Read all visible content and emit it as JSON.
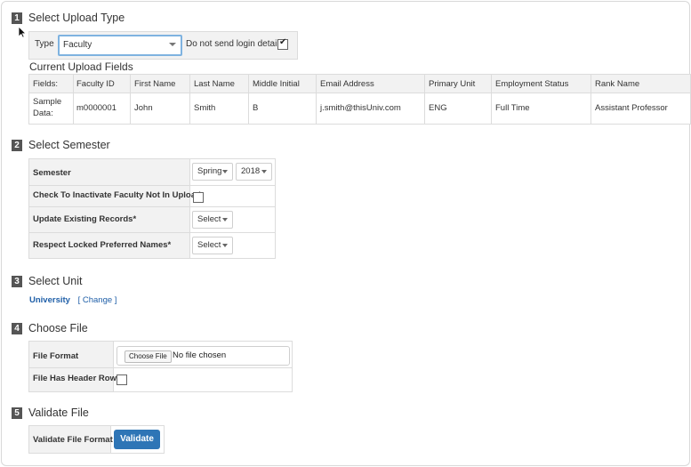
{
  "steps": [
    {
      "num": "1",
      "title": "Select Upload Type"
    },
    {
      "num": "2",
      "title": "Select Semester"
    },
    {
      "num": "3",
      "title": "Select Unit"
    },
    {
      "num": "4",
      "title": "Choose File"
    },
    {
      "num": "5",
      "title": "Validate File"
    }
  ],
  "upload_type": {
    "label": "Type",
    "selected": "Faculty",
    "no_login_label": "Do not send login details",
    "no_login_checked": true
  },
  "current_fields": {
    "heading": "Current Upload Fields",
    "row_label": "Fields:",
    "columns": [
      "Faculty ID",
      "First Name",
      "Last Name",
      "Middle Initial",
      "Email Address",
      "Primary Unit",
      "Employment Status",
      "Rank Name"
    ],
    "sample_label_line1": "Sample",
    "sample_label_line2": "Data:",
    "sample": [
      "m0000001",
      "John",
      "Smith",
      "B",
      "j.smith@thisUniv.com",
      "ENG",
      "Full Time",
      "Assistant Professor"
    ]
  },
  "semester": {
    "semester_label": "Semester",
    "term": "Spring",
    "year": "2018",
    "inactivate_label": "Check To Inactivate Faculty Not In Upload",
    "inactivate_checked": false,
    "update_label": "Update Existing Records*",
    "update_value": "Select",
    "respect_label": "Respect Locked Preferred Names*",
    "respect_value": "Select"
  },
  "unit": {
    "name": "University",
    "change_label": "[ Change ]"
  },
  "file": {
    "format_label": "File Format",
    "choose_button": "Choose File",
    "chosen_text": "No file chosen",
    "header_row_label": "File Has Header Row",
    "header_row_checked": false
  },
  "validate": {
    "label": "Validate File Format",
    "button": "Validate"
  },
  "colors": {
    "accent": "#2e75b6",
    "link": "#1f5fa8",
    "focus_border": "#7fb3e0"
  }
}
